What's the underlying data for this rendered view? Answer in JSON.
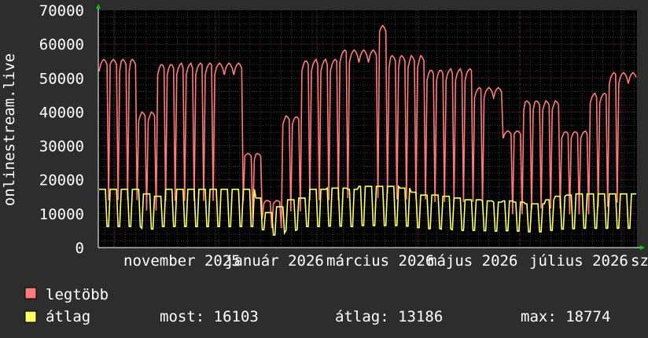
{
  "chart_data": {
    "type": "line",
    "ylabel": "onlinestream.live",
    "ylim": [
      0,
      70000
    ],
    "y_ticks": [
      0,
      10000,
      20000,
      30000,
      40000,
      50000,
      60000,
      70000
    ],
    "x_tick_labels": [
      "november 2025",
      "január 2026",
      "március 2026",
      "május 2026",
      "július 2026",
      "szeptember"
    ],
    "grid": true,
    "legend_position": "bottom-left",
    "series": [
      {
        "name": "legtöbb",
        "color": "#ff7a7a",
        "shape": {
          "weekly_pattern": [
            52000,
            54000,
            55000,
            55500,
            55000,
            54000,
            48000
          ],
          "low_value": 11000,
          "segments": [
            {
              "weeks": 4,
              "scale": 1.0
            },
            {
              "weeks": 2,
              "scale": 0.72
            },
            {
              "weeks": 9,
              "scale": 0.98
            },
            {
              "weeks": 2,
              "scale": 0.5
            },
            {
              "weeks": 2,
              "scale": 0.25
            },
            {
              "weeks": 2,
              "scale": 0.7
            },
            {
              "weeks": 4,
              "scale": 1.0
            },
            {
              "weeks": 4,
              "scale": 1.05
            },
            {
              "weeks": 1,
              "scale": 1.18
            },
            {
              "weeks": 4,
              "scale": 1.02
            },
            {
              "weeks": 5,
              "scale": 0.95
            },
            {
              "weeks": 3,
              "scale": 0.85
            },
            {
              "weeks": 2,
              "scale": 0.62
            },
            {
              "weeks": 4,
              "scale": 0.78
            },
            {
              "weeks": 3,
              "scale": 0.62
            },
            {
              "weeks": 2,
              "scale": 0.82
            },
            {
              "weeks": 3,
              "scale": 0.93
            }
          ]
        }
      },
      {
        "name": "átlag",
        "color": "#ffff66",
        "shape": {
          "high": 17200,
          "low": 6200,
          "scales": [
            1.0,
            1.0,
            1.0,
            1.0,
            0.92,
            0.88,
            1.0,
            1.0,
            1.0,
            1.0,
            1.0,
            1.0,
            1.0,
            1.0,
            1.0,
            0.85,
            0.6,
            0.7,
            0.82,
            0.85,
            1.0,
            1.0,
            1.02,
            1.02,
            1.0,
            1.05,
            1.05,
            1.05,
            1.05,
            1.02,
            0.95,
            0.9,
            0.9,
            0.88,
            0.85,
            0.82,
            0.82,
            0.8,
            0.78,
            0.8,
            0.78,
            0.75,
            0.75,
            0.82,
            0.88,
            0.9,
            0.92,
            0.92,
            0.92,
            0.92,
            0.92,
            0.92
          ]
        }
      }
    ]
  },
  "legend": {
    "items": [
      {
        "label": "legtöbb",
        "color": "#ff7a7a"
      },
      {
        "label": "átlag",
        "color": "#ffff66"
      }
    ],
    "stats": {
      "most": "most: 16103",
      "atlag": "átlag: 13186",
      "max": "max: 18774"
    }
  },
  "colors": {
    "background": "#2d2d2d",
    "plot_background": "#000000",
    "grid_minor": "#3c3c3c",
    "grid_major": "#6a2a2a",
    "axis": "#ffffff",
    "arrow": "#00cc00"
  }
}
